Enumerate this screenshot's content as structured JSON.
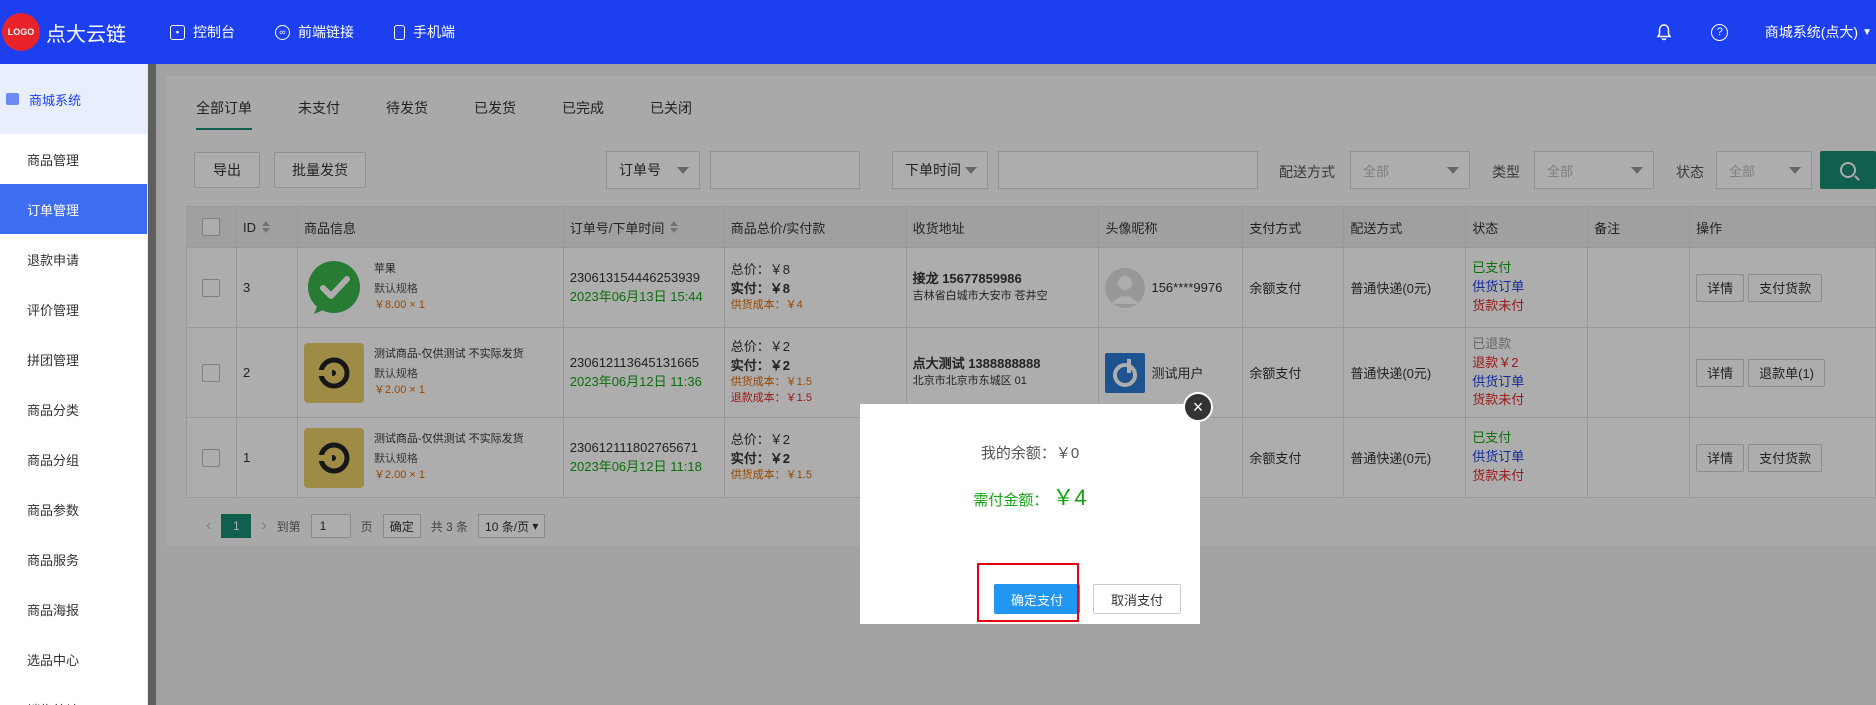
{
  "topbar": {
    "logo_badge": "LOGO",
    "logo_text": "点大云链",
    "nav": [
      {
        "label": "控制台",
        "icon": "dashboard-icon"
      },
      {
        "label": "前端链接",
        "icon": "link-icon"
      },
      {
        "label": "手机端",
        "icon": "mobile-icon"
      }
    ],
    "user_label": "商城系统(点大)"
  },
  "sidebar": {
    "section": "商城系统",
    "items": [
      "商品管理",
      "订单管理",
      "退款申请",
      "评价管理",
      "拼团管理",
      "商品分类",
      "商品分组",
      "商品参数",
      "商品服务",
      "商品海报",
      "选品中心",
      "销售统计"
    ],
    "active_index": 1
  },
  "tabs": [
    "全部订单",
    "未支付",
    "待发货",
    "已发货",
    "已完成",
    "已关闭"
  ],
  "filters": {
    "export_label": "导出",
    "batch_ship_label": "批量发货",
    "order_field": "订单号",
    "time_field": "下单时间",
    "delivery_label": "配送方式",
    "delivery_value": "全部",
    "type_label": "类型",
    "type_value": "全部",
    "status_label": "状态",
    "status_value": "全部"
  },
  "table": {
    "headers": [
      "ID",
      "商品信息",
      "订单号/下单时间",
      "商品总价/实付款",
      "收货地址",
      "头像昵称",
      "支付方式",
      "配送方式",
      "状态",
      "备注",
      "操作"
    ],
    "rows": [
      {
        "id": "3",
        "product_name": "苹果",
        "spec": "默认规格",
        "unit_price": "￥8.00 × 1",
        "order_no": "230613154446253939",
        "order_time": "2023年06月13日 15:44",
        "total": "总价：￥8",
        "paid": "实付：￥8",
        "cost": "供货成本：￥4",
        "refund_cost": "",
        "receiver": "接龙 15677859986",
        "address": "吉林省白城市大安市 苍井空",
        "nickname": "156****9976",
        "pay_method": "余额支付",
        "delivery": "普通快递(0元)",
        "status": [
          "已支付",
          "供货订单",
          "货款未付"
        ],
        "status_colors": [
          "#14a314",
          "#1d3fe3",
          "#e12a2a"
        ],
        "ops": [
          "详情",
          "支付货款"
        ]
      },
      {
        "id": "2",
        "product_name": "测试商品-仅供测试 不实际发货",
        "spec": "默认规格",
        "unit_price": "￥2.00 × 1",
        "order_no": "230612113645131665",
        "order_time": "2023年06月12日 11:36",
        "total": "总价：￥2",
        "paid": "实付：￥2",
        "cost": "供货成本：￥1.5",
        "refund_cost": "退款成本：￥1.5",
        "receiver": "点大测试 1388888888",
        "address": "北京市北京市东城区 01",
        "nickname": "测试用户",
        "pay_method": "余额支付",
        "delivery": "普通快递(0元)",
        "status": [
          "已退款",
          "退款￥2",
          "供货订单",
          "货款未付"
        ],
        "status_colors": [
          "#999999",
          "#e12a2a",
          "#1d3fe3",
          "#e12a2a"
        ],
        "ops": [
          "详情",
          "退款单(1)"
        ]
      },
      {
        "id": "1",
        "product_name": "测试商品-仅供测试 不实际发货",
        "spec": "默认规格",
        "unit_price": "￥2.00 × 1",
        "order_no": "230612111802765671",
        "order_time": "2023年06月12日 11:18",
        "total": "总价：￥2",
        "paid": "实付：￥2",
        "cost": "供货成本：￥1.5",
        "refund_cost": "",
        "receiver": "",
        "address": "",
        "nickname": "",
        "pay_method": "余额支付",
        "delivery": "普通快递(0元)",
        "status": [
          "已支付",
          "供货订单",
          "货款未付"
        ],
        "status_colors": [
          "#14a314",
          "#1d3fe3",
          "#e12a2a"
        ],
        "ops": [
          "详情",
          "支付货款"
        ]
      }
    ]
  },
  "pager": {
    "current": "1",
    "goto_label": "到第",
    "goto_value": "1",
    "page_unit": "页",
    "confirm": "确定",
    "total": "共 3 条",
    "page_size": "10 条/页"
  },
  "modal": {
    "balance_label": "我的余额：￥0",
    "need_label": "需付金额：",
    "need_amount": "￥4",
    "confirm_label": "确定支付",
    "cancel_label": "取消支付",
    "close_glyph": "×"
  },
  "colors": {
    "topbar": "#1c3ff0",
    "accent": "#1a8c72",
    "sidebar_active": "#3f6df2",
    "confirm_button": "#2196f3",
    "highlight": "#e60012"
  }
}
